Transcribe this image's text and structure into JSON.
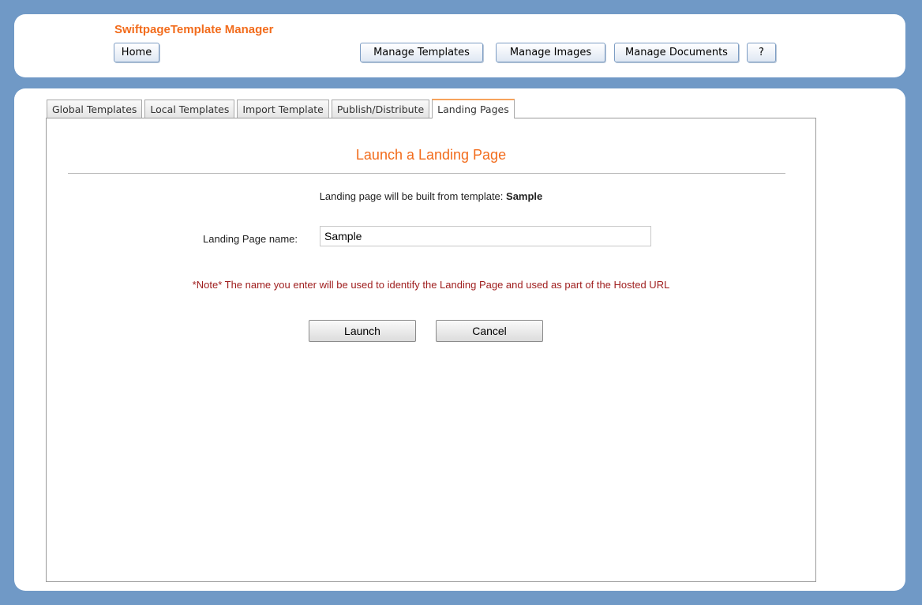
{
  "header": {
    "app_title": "SwiftpageTemplate Manager",
    "home_label": "Home",
    "manage_templates_label": "Manage Templates",
    "manage_images_label": "Manage Images",
    "manage_documents_label": "Manage Documents",
    "help_label": "?"
  },
  "tabs": [
    {
      "label": "Global Templates",
      "active": false
    },
    {
      "label": "Local Templates",
      "active": false
    },
    {
      "label": "Import Template",
      "active": false
    },
    {
      "label": "Publish/Distribute",
      "active": false
    },
    {
      "label": "Landing Pages",
      "active": true
    }
  ],
  "landing": {
    "title": "Launch a Landing Page",
    "built_from_text": "Landing page will be built from template:",
    "template_name": "Sample",
    "name_label": "Landing Page name:",
    "name_value": "Sample",
    "note": "*Note* The name you enter will be used to identify the Landing Page and used as part of the Hosted URL",
    "launch_label": "Launch",
    "cancel_label": "Cancel"
  },
  "colors": {
    "background": "#7099c6",
    "accent_orange": "#f26c1c",
    "note_red": "#9e1c1c"
  }
}
